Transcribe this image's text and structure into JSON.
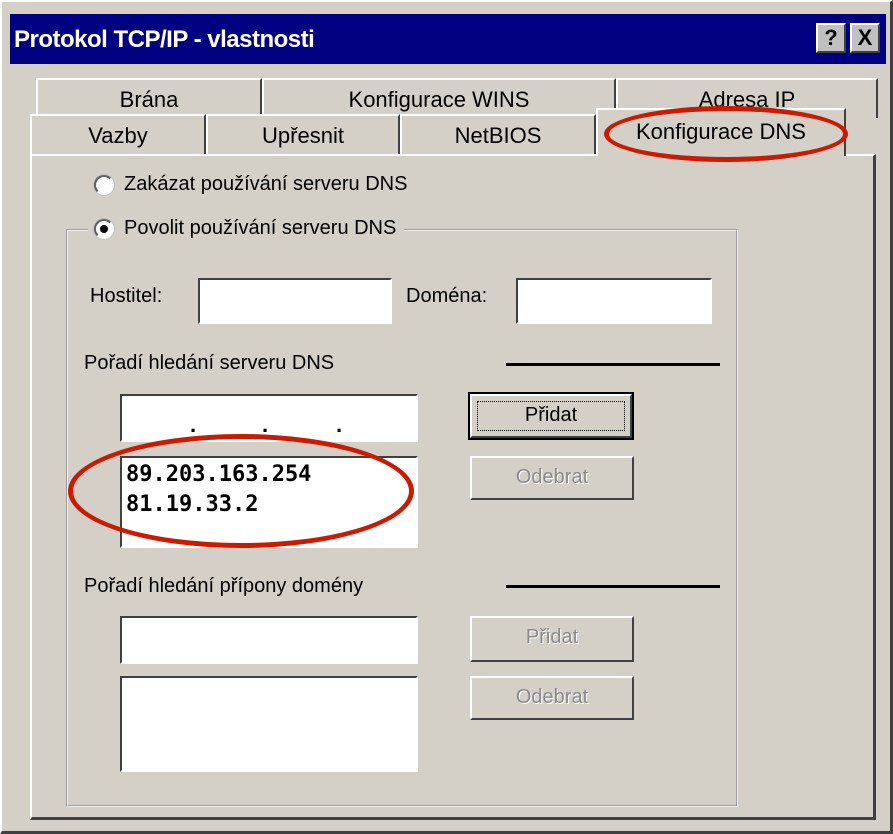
{
  "window": {
    "title": "Protokol TCP/IP - vlastnosti",
    "help_btn": "?",
    "close_btn": "X"
  },
  "tabs_back": [
    {
      "label": "Brána"
    },
    {
      "label": "Konfigurace WINS"
    },
    {
      "label": "Adresa IP"
    }
  ],
  "tabs_front": [
    {
      "label": "Vazby"
    },
    {
      "label": "Upřesnit"
    },
    {
      "label": "NetBIOS"
    },
    {
      "label": "Konfigurace DNS"
    }
  ],
  "active_tab": "Konfigurace DNS",
  "dns": {
    "disable_radio": "Zakázat používání serveru DNS",
    "enable_radio": "Povolit používání serveru DNS",
    "enabled": true,
    "host_label": "Hostitel:",
    "host_value": "",
    "domain_label": "Doména:",
    "domain_value": "",
    "server_order_label": "Pořadí hledání serveru DNS",
    "ip_entry_dots": ".",
    "servers": [
      "89.203.163.254",
      "81.19.33.2"
    ],
    "add_button": "Přidat",
    "remove_button": "Odebrat",
    "suffix_order_label": "Pořadí hledání přípony domény",
    "suffix_input": "",
    "suffixes": [],
    "suffix_add_button": "Přidat",
    "suffix_remove_button": "Odebrat"
  },
  "colors": {
    "titlebar": "#000080",
    "highlight": "#cc1a00",
    "face": "#d4d0c8"
  }
}
